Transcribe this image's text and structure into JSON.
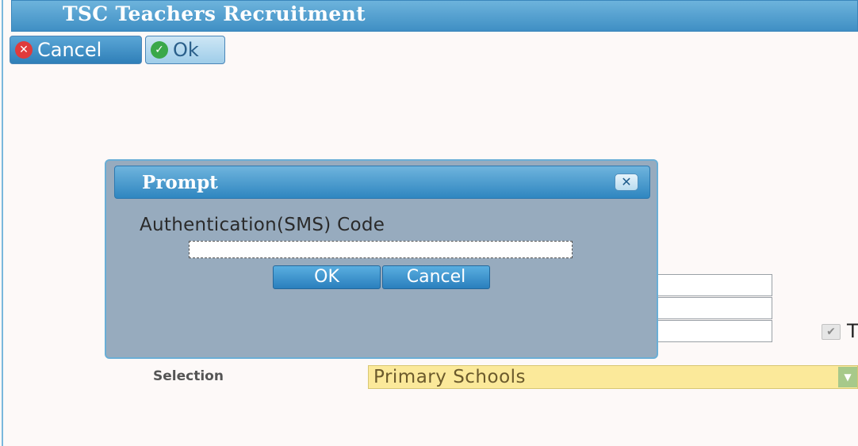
{
  "app": {
    "title": "TSC Teachers Recruitment"
  },
  "toolbar": {
    "cancel_label": "Cancel",
    "ok_label": "Ok"
  },
  "form": {
    "selection_label": "Selection",
    "selection_value": "Primary Schools",
    "checkbox_label": "T"
  },
  "dialog": {
    "title": "Prompt",
    "field_label": "Authentication(SMS) Code",
    "field_value": "",
    "ok_label": "OK",
    "cancel_label": "Cancel"
  },
  "icons": {
    "cancel": "cancel-x-icon",
    "ok": "check-icon",
    "close": "close-icon",
    "dropdown": "chevron-down-icon"
  },
  "colors": {
    "accent": "#3f8fc4",
    "dialog_bg": "#97abbe",
    "select_bg": "#fbe99a"
  }
}
